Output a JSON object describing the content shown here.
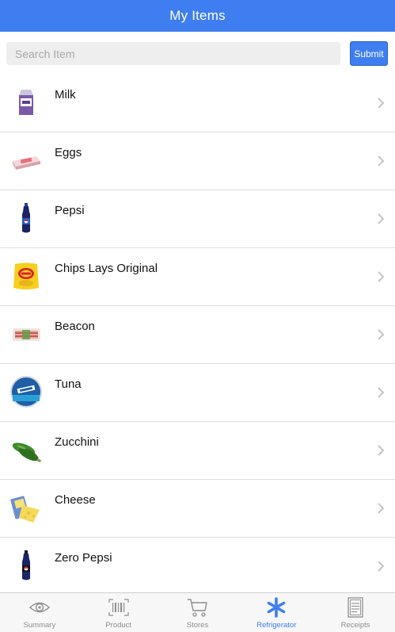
{
  "header": {
    "title": "My Items"
  },
  "search": {
    "placeholder": "Search Item",
    "value": "",
    "submit_label": "Submit"
  },
  "items": [
    {
      "name": "Milk"
    },
    {
      "name": "Eggs"
    },
    {
      "name": "Pepsi"
    },
    {
      "name": "Chips Lays Original"
    },
    {
      "name": "Beacon"
    },
    {
      "name": "Tuna"
    },
    {
      "name": "Zucchini"
    },
    {
      "name": "Cheese"
    },
    {
      "name": "Zero Pepsi"
    }
  ],
  "tabs": [
    {
      "label": "Summary",
      "icon": "eye-icon"
    },
    {
      "label": "Product",
      "icon": "barcode-icon"
    },
    {
      "label": "Stores",
      "icon": "cart-icon"
    },
    {
      "label": "Refrigerator",
      "icon": "asterisk-icon",
      "active": true
    },
    {
      "label": "Receipts",
      "icon": "receipt-icon"
    }
  ],
  "colors": {
    "accent": "#3e7ef0",
    "inactive": "#8e8e8e",
    "divider": "#dcdcdc"
  }
}
